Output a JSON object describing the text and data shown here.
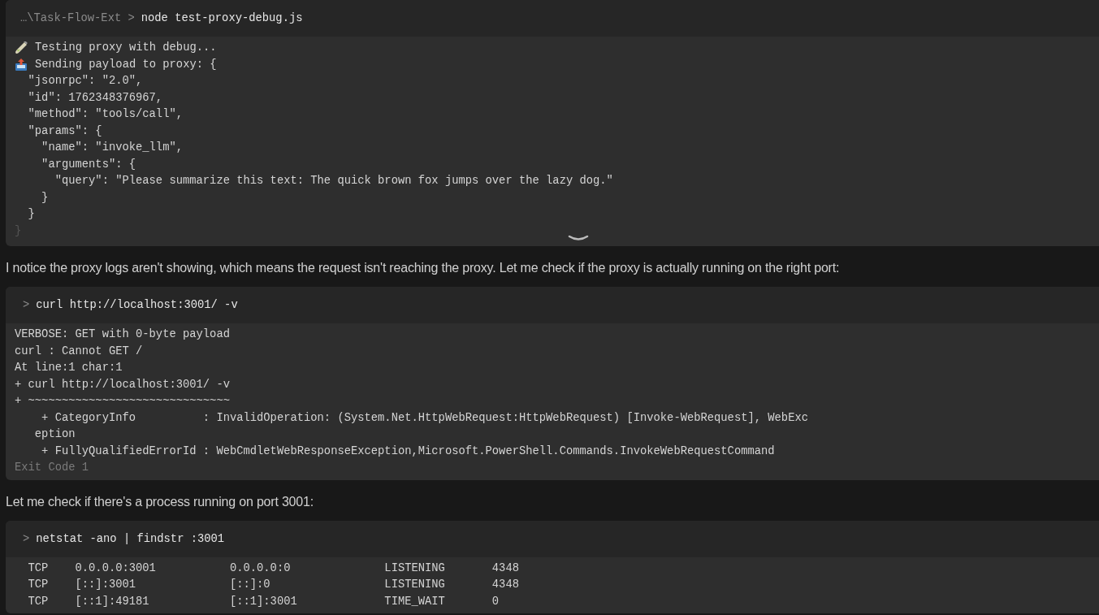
{
  "blocks": [
    {
      "kind": "terminal",
      "cwd": "…\\Task-Flow-Ext >",
      "command": "node test-proxy-debug.js",
      "collapsed": true,
      "lines": [
        {
          "kind": "tube",
          "text": "Testing proxy with debug..."
        },
        {
          "kind": "outbox",
          "text": "Sending payload to proxy: {"
        },
        {
          "kind": "plain",
          "text": "  \"jsonrpc\": \"2.0\","
        },
        {
          "kind": "plain",
          "text": "  \"id\": 1762348376967,"
        },
        {
          "kind": "plain",
          "text": "  \"method\": \"tools/call\","
        },
        {
          "kind": "plain",
          "text": "  \"params\": {"
        },
        {
          "kind": "plain",
          "text": "    \"name\": \"invoke_llm\","
        },
        {
          "kind": "plain",
          "text": "    \"arguments\": {"
        },
        {
          "kind": "plain",
          "text": "      \"query\": \"Please summarize this text: The quick brown fox jumps over the lazy dog.\""
        },
        {
          "kind": "plain",
          "text": "    }"
        },
        {
          "kind": "plain",
          "text": "  }"
        },
        {
          "kind": "faded",
          "text": "}"
        }
      ]
    },
    {
      "kind": "message",
      "text": "I notice the proxy logs aren't showing, which means the request isn't reaching the proxy. Let me check if the proxy is actually running on the right port:"
    },
    {
      "kind": "terminal",
      "prompt": ">",
      "command": "curl http://localhost:3001/ -v",
      "collapsed": false,
      "lines": [
        {
          "kind": "plain",
          "text": "VERBOSE: GET with 0-byte payload"
        },
        {
          "kind": "plain",
          "text": "curl : Cannot GET /"
        },
        {
          "kind": "plain",
          "text": "At line:1 char:1"
        },
        {
          "kind": "plain",
          "text": "+ curl http://localhost:3001/ -v"
        },
        {
          "kind": "plain",
          "text": "+ ~~~~~~~~~~~~~~~~~~~~~~~~~~~~~~"
        },
        {
          "kind": "plain",
          "text": "    + CategoryInfo          : InvalidOperation: (System.Net.HttpWebRequest:HttpWebRequest) [Invoke-WebRequest], WebExc"
        },
        {
          "kind": "plain",
          "text": "   eption"
        },
        {
          "kind": "plain",
          "text": "    + FullyQualifiedErrorId : WebCmdletWebResponseException,Microsoft.PowerShell.Commands.InvokeWebRequestCommand"
        }
      ],
      "exit_code": "Exit Code 1"
    },
    {
      "kind": "message",
      "text": "Let me check if there's a process running on port 3001:"
    },
    {
      "kind": "terminal",
      "prompt": ">",
      "command": "netstat -ano | findstr :3001",
      "collapsed": false,
      "lines": [
        {
          "kind": "plain",
          "text": "  TCP    0.0.0.0:3001           0.0.0.0:0              LISTENING       4348"
        },
        {
          "kind": "plain",
          "text": "  TCP    [::]:3001              [::]:0                 LISTENING       4348"
        },
        {
          "kind": "plain",
          "text": "  TCP    [::1]:49181            [::1]:3001             TIME_WAIT       0"
        }
      ]
    }
  ]
}
